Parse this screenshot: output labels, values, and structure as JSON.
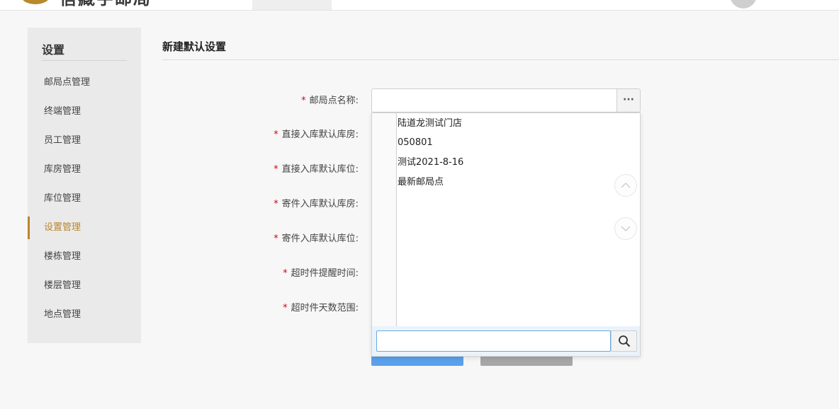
{
  "header": {
    "app_title": "信藏宇邮局",
    "logo_icon": "logo-mark-icon",
    "brand_color": "#b8862b"
  },
  "sidebar": {
    "title": "设置",
    "active_index": 5,
    "items": [
      {
        "label": "邮局点管理"
      },
      {
        "label": "终端管理"
      },
      {
        "label": "员工管理"
      },
      {
        "label": "库房管理"
      },
      {
        "label": "库位管理"
      },
      {
        "label": "设置管理"
      },
      {
        "label": "楼栋管理"
      },
      {
        "label": "楼层管理"
      },
      {
        "label": "地点管理"
      }
    ]
  },
  "main": {
    "title": "新建默认设置",
    "required_mark": "*",
    "fields": [
      {
        "label": "邮局点名称:"
      },
      {
        "label": "直接入库默认库房:"
      },
      {
        "label": "直接入库默认库位:"
      },
      {
        "label": "寄件入库默认库房:"
      },
      {
        "label": "寄件入库默认库位:"
      },
      {
        "label": "超时件提醒时间:"
      },
      {
        "label": "超时件天数范围:"
      }
    ],
    "name_field_value": "",
    "more_button_label": "···"
  },
  "dropdown": {
    "options": [
      "陆道龙测试门店",
      "050801",
      "测试2021-8-16",
      "最新邮局点"
    ],
    "search_value": "",
    "scroll_up_icon": "chevron-up-icon",
    "scroll_down_icon": "chevron-down-icon",
    "search_icon": "search-icon"
  },
  "colors": {
    "required": "#d0021b",
    "save_button": "#5aa0ec",
    "cancel_button": "#a7a7a7"
  }
}
